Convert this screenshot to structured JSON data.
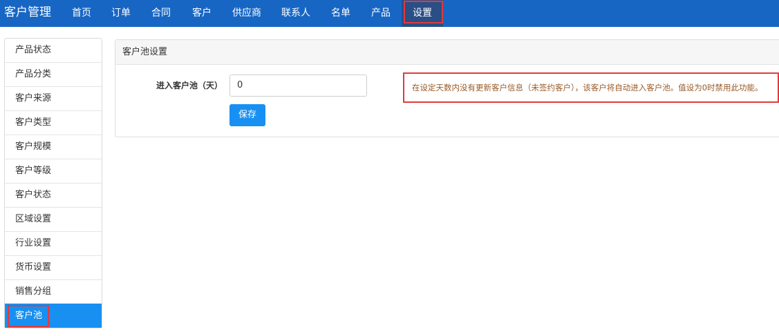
{
  "app": {
    "title": "客户管理"
  },
  "nav": [
    {
      "label": "首页"
    },
    {
      "label": "订单"
    },
    {
      "label": "合同"
    },
    {
      "label": "客户"
    },
    {
      "label": "供应商"
    },
    {
      "label": "联系人"
    },
    {
      "label": "名单"
    },
    {
      "label": "产品"
    },
    {
      "label": "设置",
      "active": true
    }
  ],
  "sidebar": {
    "items": [
      {
        "label": "产品状态"
      },
      {
        "label": "产品分类"
      },
      {
        "label": "客户来源"
      },
      {
        "label": "客户类型"
      },
      {
        "label": "客户规模"
      },
      {
        "label": "客户等级"
      },
      {
        "label": "客户状态"
      },
      {
        "label": "区域设置"
      },
      {
        "label": "行业设置"
      },
      {
        "label": "货币设置"
      },
      {
        "label": "销售分组"
      },
      {
        "label": "客户池",
        "active": true
      }
    ]
  },
  "panel": {
    "title": "客户池设置",
    "field_label": "进入客户池（天）",
    "field_value": "0",
    "save_label": "保存",
    "hint": "在设定天数内没有更新客户信息（未签约客户），该客户将自动进入客户池。值设为0时禁用此功能。"
  },
  "colors": {
    "topbar": "#1766c4",
    "accent": "#1890f2",
    "highlight": "#e23a3a",
    "hint_text": "#9a5a26"
  }
}
